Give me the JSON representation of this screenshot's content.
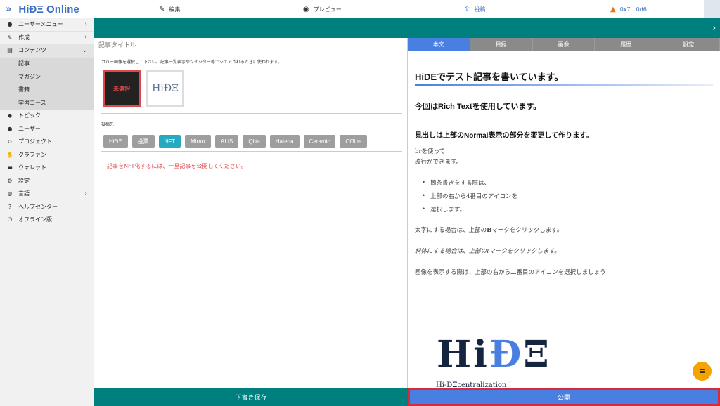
{
  "app": {
    "brand": "HiĐΞ Online",
    "menu_toggle": "»"
  },
  "topnav": {
    "edit": "編集",
    "preview": "プレビュー",
    "post": "投稿",
    "wallet": "0x7…0d6"
  },
  "sidebar": {
    "items": [
      {
        "label": "ユーザーメニュー",
        "icon": "user-icon",
        "caret": "›"
      },
      {
        "label": "作成",
        "icon": "edit-icon",
        "caret": "›"
      },
      {
        "label": "コンテンツ",
        "icon": "content-icon",
        "caret": "⌄"
      }
    ],
    "sub_items": [
      "記事",
      "マガジン",
      "書籍",
      "学習コース"
    ],
    "more_items": [
      {
        "label": "トピック",
        "icon": "tag-icon"
      },
      {
        "label": "ユーザー",
        "icon": "users-icon"
      },
      {
        "label": "プロジェクト",
        "icon": "code-icon"
      },
      {
        "label": "クラファン",
        "icon": "crowdfund-icon"
      },
      {
        "label": "ウォレット",
        "icon": "wallet-icon"
      },
      {
        "label": "設定",
        "icon": "settings-icon"
      },
      {
        "label": "言語",
        "icon": "globe-icon",
        "caret": "›"
      },
      {
        "label": "ヘルプセンター",
        "icon": "help-icon"
      },
      {
        "label": "オフライン版",
        "icon": "power-icon"
      }
    ]
  },
  "editor": {
    "title_placeholder": "記事タイトル",
    "cover_note": "カバー画像を選択して下さい。記事一覧表示やツイッター等でシェアされるときに使われます。",
    "cover_unselected": "未選択",
    "cover_logo": "HiĐΞ",
    "dest_label": "投稿先",
    "destinations": [
      "HiĐΞ",
      "投票",
      "NFT",
      "Mirror",
      "ALIS",
      "Qiita",
      "Hatena",
      "Ceramic",
      "Offline"
    ],
    "active_destination": "NFT",
    "warning": "記事をNFT化するには、一旦記事を公開してください。",
    "draft_save": "下書き保存",
    "warning_color": "#e0474c"
  },
  "preview": {
    "tabs": [
      "本文",
      "目録",
      "画像",
      "履歴",
      "設定"
    ],
    "active_tab": "本文",
    "h1": "HiDEでテスト記事を書いています。",
    "h2": "今回はRich Textを使用しています。",
    "h3": "見出しは上部のNormal表示の部分を変更して作ります。",
    "p1": "brを使って",
    "p2": "改行ができます。",
    "bullets": [
      "箇条書きをする際は、",
      "上部の右から4番目のアイコンを",
      "選択します。"
    ],
    "bold_pre": "太字にする場合は、上部の",
    "bold_b": "B",
    "bold_post": "マークをクリックします。",
    "italic_text": "斜体にする場合は、上部のIマークをクリックします。",
    "image_text": "画像を表示する際は、上部の右から二番目のアイコンを選択しましょう",
    "logo_text_left": "Hi",
    "logo_text_d": "Đ",
    "logo_text_right": "Ξ",
    "logo_sub": "Hi-DΞcentralization !",
    "fab_icon": "≡",
    "publish": "公開"
  },
  "colors": {
    "teal": "#007f7f",
    "accent_blue": "#4a7fe2",
    "publish_highlight": "#d52b3b",
    "fab": "#f5a300"
  }
}
